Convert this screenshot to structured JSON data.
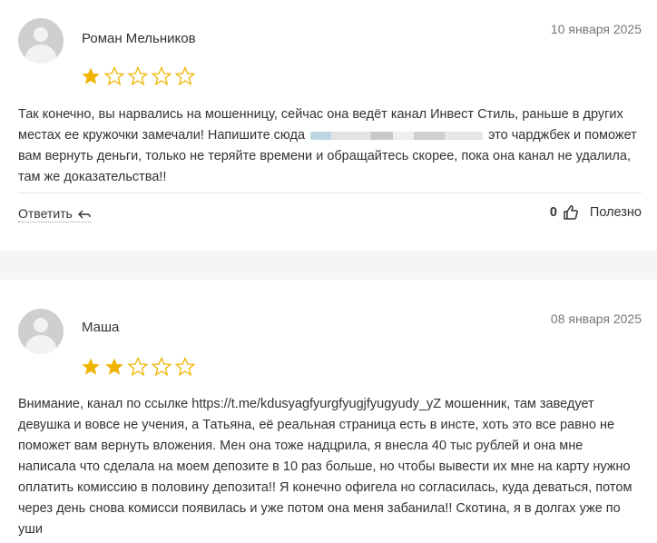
{
  "reviews": [
    {
      "author": "Роман Мельников",
      "date": "10 января 2025",
      "rating": 1,
      "text_before_link": "Так конечно, вы нарвались на мошенницу, сейчас она ведёт канал Инвест Стиль, раньше в других местах ее кружочки замечали! Напишите сюда",
      "text_after_link": "это чарджбек и поможет вам вернуть деньги, только не теряйте времени и обращайтесь скорее, пока она канал не удалила, там же доказательства!!",
      "reply_label": "Ответить",
      "votes": "0",
      "useful_label": "Полезно"
    },
    {
      "author": "Маша",
      "date": "08 января 2025",
      "rating": 2,
      "text": "Внимание, канал по ссылке https://t.me/kdusyagfyurgfyugjfyugyudy_yZ мошенник, там заведует девушка и вовсе не учения, а Татьяна, её реальная страница есть в инсте, хоть это все равно не поможет вам вернуть вложения. Мен она тоже надцрила, я внесла 40 тыс рублей и она мне написала что сделала на моем депозите в 10 раз больше, но чтобы вывести их мне на карту нужно оплатить комиссию в половину депозита!! Я конечно офигела но согласилась, куда деваться, потом через день снова комисси появилась и уже потом она меня забанила!! Скотина, я в долгах уже по уши"
    }
  ],
  "colors": {
    "star": "#f0b400",
    "avatar": "#cfcfcf"
  },
  "icons": {
    "star": "star-icon",
    "reply": "reply-arrow-icon",
    "thumb": "thumbs-up-icon"
  }
}
